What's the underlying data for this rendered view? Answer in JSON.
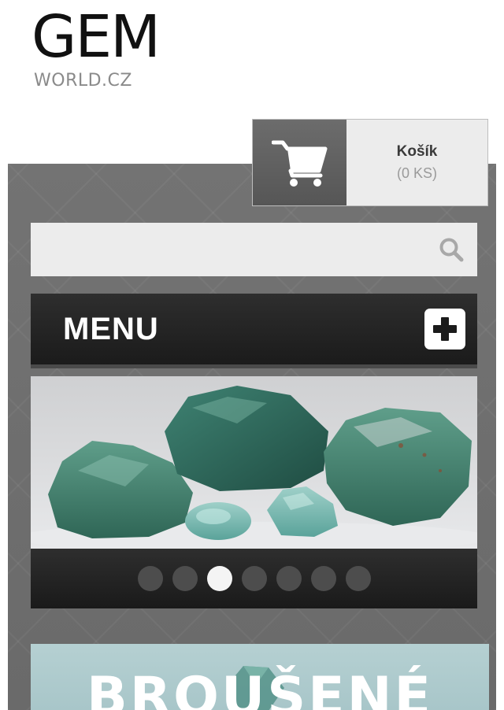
{
  "header": {
    "logo_main": "GEM",
    "logo_sub": "WORLD.CZ"
  },
  "cart": {
    "label": "Košík",
    "count": "(0 KS)",
    "icon": "shopping-cart-icon"
  },
  "search": {
    "value": "",
    "placeholder": "",
    "icon": "search-icon"
  },
  "menu": {
    "label": "MENU",
    "toggle_icon": "plus-icon"
  },
  "slider": {
    "total_slides": 7,
    "active_index": 2
  },
  "banner": {
    "text": "BROUŠENÉ"
  },
  "colors": {
    "background": "#6b6b6b",
    "menu_bar": "#1b1b1b",
    "cart_bg": "#ececec",
    "search_bg": "#ececec",
    "active_dot": "#f4f4f4",
    "inactive_dot": "#4d4d4d",
    "banner_bg": "#b5d0d2"
  }
}
